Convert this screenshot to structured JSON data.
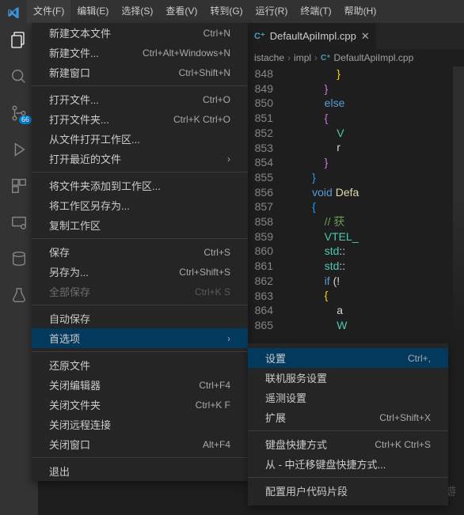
{
  "menubar": {
    "items": [
      "文件(F)",
      "编辑(E)",
      "选择(S)",
      "查看(V)",
      "转到(G)",
      "运行(R)",
      "终端(T)",
      "帮助(H)"
    ],
    "activeIndex": 0
  },
  "activitybar": {
    "badge": "66"
  },
  "fileMenu": {
    "groups": [
      [
        {
          "label": "新建文本文件",
          "kb": "Ctrl+N"
        },
        {
          "label": "新建文件...",
          "kb": "Ctrl+Alt+Windows+N"
        },
        {
          "label": "新建窗口",
          "kb": "Ctrl+Shift+N"
        }
      ],
      [
        {
          "label": "打开文件...",
          "kb": "Ctrl+O"
        },
        {
          "label": "打开文件夹...",
          "kb": "Ctrl+K Ctrl+O"
        },
        {
          "label": "从文件打开工作区..."
        },
        {
          "label": "打开最近的文件",
          "sub": true
        }
      ],
      [
        {
          "label": "将文件夹添加到工作区..."
        },
        {
          "label": "将工作区另存为..."
        },
        {
          "label": "复制工作区"
        }
      ],
      [
        {
          "label": "保存",
          "kb": "Ctrl+S"
        },
        {
          "label": "另存为...",
          "kb": "Ctrl+Shift+S"
        },
        {
          "label": "全部保存",
          "kb": "Ctrl+K S",
          "disabled": true
        }
      ],
      [
        {
          "label": "自动保存"
        },
        {
          "label": "首选项",
          "sub": true,
          "selected": true
        }
      ],
      [
        {
          "label": "还原文件"
        },
        {
          "label": "关闭编辑器",
          "kb": "Ctrl+F4"
        },
        {
          "label": "关闭文件夹",
          "kb": "Ctrl+K F"
        },
        {
          "label": "关闭远程连接"
        },
        {
          "label": "关闭窗口",
          "kb": "Alt+F4"
        }
      ],
      [
        {
          "label": "退出"
        }
      ]
    ]
  },
  "prefSubmenu": {
    "groups": [
      [
        {
          "label": "设置",
          "kb": "Ctrl+,",
          "selected": true
        },
        {
          "label": "联机服务设置"
        },
        {
          "label": "遥测设置"
        },
        {
          "label": "扩展",
          "kb": "Ctrl+Shift+X"
        }
      ],
      [
        {
          "label": "键盘快捷方式",
          "kb": "Ctrl+K Ctrl+S"
        },
        {
          "label": "从 - 中迁移键盘快捷方式..."
        }
      ],
      [
        {
          "label": "配置用户代码片段"
        }
      ]
    ]
  },
  "tab": {
    "name": "DefaultApiImpl.cpp",
    "closeGlyph": "✕"
  },
  "breadcrumbs": [
    "istache",
    "impl",
    "DefaultApiImpl.cpp"
  ],
  "code": {
    "startLine": 848,
    "lines": [
      {
        "text": "                }",
        "cls": "brace-y"
      },
      {
        "text": "            }",
        "cls": "brace-p"
      },
      {
        "text": "            else",
        "cls": "kw"
      },
      {
        "text": "            {",
        "cls": "brace-p"
      },
      {
        "text": "                V",
        "cls": "ty"
      },
      {
        "text": "                r",
        "cls": "pn"
      },
      {
        "text": "            }",
        "cls": "brace-p"
      },
      {
        "text": "        }",
        "cls": "brace-b"
      },
      {
        "text": "        void Defa",
        "cls": "kw",
        "mixed": [
          {
            "t": "        ",
            "c": "pn"
          },
          {
            "t": "void ",
            "c": "kw"
          },
          {
            "t": "Defa",
            "c": "fn"
          }
        ]
      },
      {
        "text": "        {",
        "cls": "brace-b"
      },
      {
        "text": "            // 获",
        "cls": "cm"
      },
      {
        "text": "            VTEL_",
        "cls": "ty"
      },
      {
        "text": "            std::",
        "cls": "ty",
        "mixed": [
          {
            "t": "            ",
            "c": "pn"
          },
          {
            "t": "std",
            "c": "ty"
          },
          {
            "t": "::",
            "c": "pn"
          }
        ]
      },
      {
        "text": "            std::",
        "mixed": [
          {
            "t": "            ",
            "c": "pn"
          },
          {
            "t": "std",
            "c": "ty"
          },
          {
            "t": "::",
            "c": "pn"
          }
        ]
      },
      {
        "text": "            if (!",
        "mixed": [
          {
            "t": "            ",
            "c": "pn"
          },
          {
            "t": "if ",
            "c": "kw"
          },
          {
            "t": "(!",
            "c": "pn"
          }
        ]
      },
      {
        "text": "            {",
        "cls": "brace-y"
      },
      {
        "text": "                a",
        "cls": "pn"
      },
      {
        "text": "                W",
        "cls": "ty"
      }
    ]
  },
  "watermark": "CSDN @迷茫的蜉蝣"
}
